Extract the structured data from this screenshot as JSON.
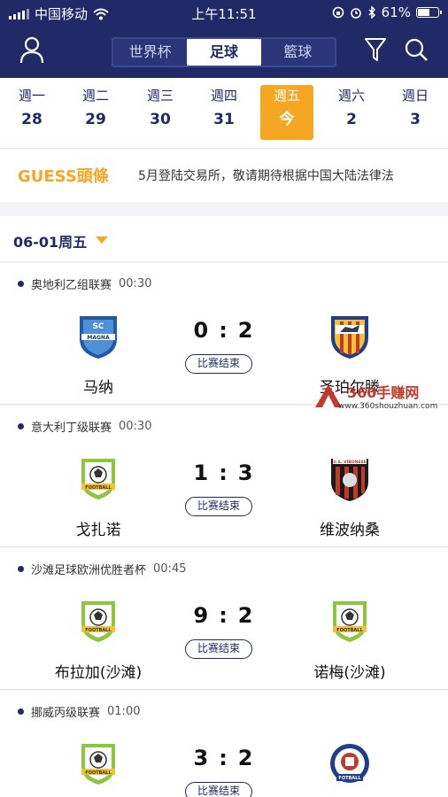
{
  "status_bar": {
    "carrier": "中国移动",
    "time": "上午11:51",
    "battery": "61%",
    "battery_level": 0.61
  },
  "header": {
    "tabs": [
      {
        "label": "世界杯",
        "active": false
      },
      {
        "label": "足球",
        "active": true
      },
      {
        "label": "籃球",
        "active": false
      }
    ],
    "icons": {
      "profile": "user-icon",
      "filter": "filter-icon",
      "search": "search-icon"
    }
  },
  "week": [
    {
      "day": "週一",
      "date": "28",
      "active": false
    },
    {
      "day": "週二",
      "date": "29",
      "active": false
    },
    {
      "day": "週三",
      "date": "30",
      "active": false
    },
    {
      "day": "週四",
      "date": "31",
      "active": false
    },
    {
      "day": "週五",
      "date": "今",
      "active": true
    },
    {
      "day": "週六",
      "date": "2",
      "active": false
    },
    {
      "day": "週日",
      "date": "3",
      "active": false
    }
  ],
  "headline": {
    "brand": "GUESS頭條",
    "text": "5月登陆交易所，敬请期待根据中国大陆法律法"
  },
  "date_header": {
    "label": "06-01周五",
    "icon": "caret-down-icon"
  },
  "matches": [
    {
      "league": "奥地利乙组联赛",
      "time": "00:30",
      "home": "马纳",
      "away": "圣珀尔滕",
      "home_score": "0",
      "away_score": "2",
      "status": "比赛结束",
      "home_crest": "magna-crest",
      "away_crest": "st-polten-crest"
    },
    {
      "league": "意大利丁级联赛",
      "time": "00:30",
      "home": "戈扎诺",
      "away": "维波纳桑",
      "home_score": "1",
      "away_score": "3",
      "status": "比赛结束",
      "home_crest": "football-crest",
      "away_crest": "vibonese-crest"
    },
    {
      "league": "沙滩足球欧洲优胜者杯",
      "time": "00:45",
      "home": "布拉加(沙滩)",
      "away": "诺梅(沙滩)",
      "home_score": "9",
      "away_score": "2",
      "status": "比赛结束",
      "home_crest": "football-crest",
      "away_crest": "football-crest"
    },
    {
      "league": "挪威丙级联赛",
      "time": "01:00",
      "home": "",
      "away": "",
      "home_score": "3",
      "away_score": "2",
      "status": "比赛结束",
      "home_crest": "football-crest",
      "away_crest": "fotball-crest"
    }
  ],
  "watermark": {
    "title": "360手赚网",
    "url": "www.360shouzhuan.com"
  },
  "colors": {
    "navy": "#1f2a66",
    "orange": "#f5a623"
  }
}
